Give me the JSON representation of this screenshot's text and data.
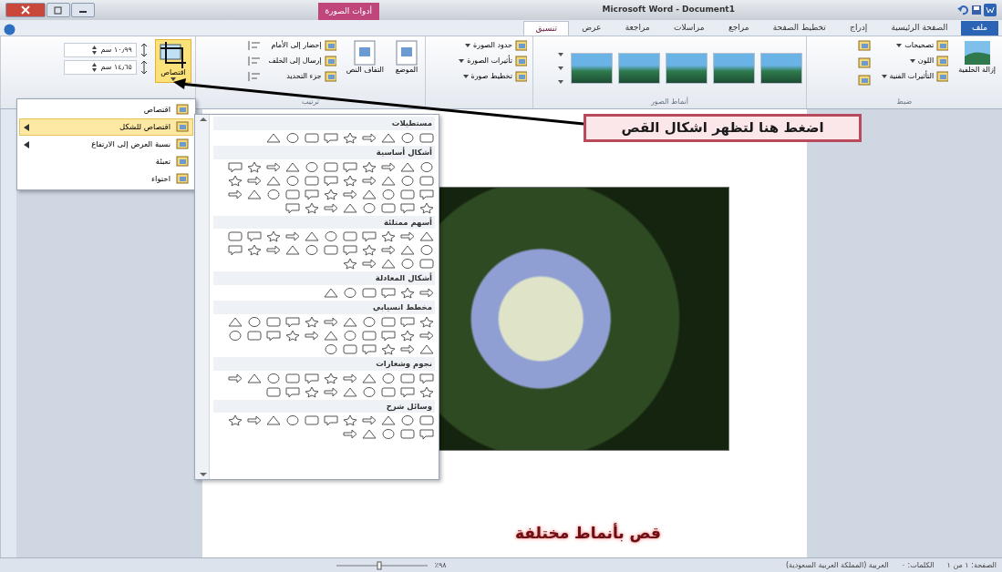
{
  "window": {
    "title": "Microsoft Word - Document1",
    "context_tab_header": "أدوات الصورة"
  },
  "tabs": [
    {
      "label": "ملف",
      "kind": "file",
      "selected": false
    },
    {
      "label": "الصفحة الرئيسية",
      "kind": "tab",
      "selected": false
    },
    {
      "label": "إدراج",
      "kind": "tab",
      "selected": false
    },
    {
      "label": "تخطيط الصفحة",
      "kind": "tab",
      "selected": false
    },
    {
      "label": "مراجع",
      "kind": "tab",
      "selected": false
    },
    {
      "label": "مراسلات",
      "kind": "tab",
      "selected": false
    },
    {
      "label": "مراجعة",
      "kind": "tab",
      "selected": false
    },
    {
      "label": "عرض",
      "kind": "tab",
      "selected": false
    },
    {
      "label": "تنسيق",
      "kind": "context",
      "selected": true
    }
  ],
  "ribbon": {
    "adjust": {
      "label": "ضبط",
      "remove_background": "إزالة الخلفية",
      "items": [
        "تصحيحات",
        "اللون",
        "التأثيرات الفنية"
      ]
    },
    "styles": {
      "label": "أنماط الصور"
    },
    "picture_options": [
      "حدود الصورة",
      "تأثيرات الصورة",
      "تخطيط صورة"
    ],
    "arrange": {
      "label": "ترتيب",
      "position": "الموضع",
      "wrap_text": "التفاف النص",
      "items": [
        "إحضار إلى الأمام",
        "إرسال إلى الخلف",
        "جزء التحديد"
      ]
    },
    "size": {
      "crop": "اقتصاص",
      "height": "١٠٫٩٩ سم",
      "width": "١٤٫٦٥ سم",
      "crop_active": true
    }
  },
  "crop_menu": [
    {
      "label": "اقتصاص",
      "submenu": false,
      "selected": false
    },
    {
      "label": "اقتصاص للشكل",
      "submenu": true,
      "selected": true
    },
    {
      "label": "نسبة العرض إلى الارتفاع",
      "submenu": true,
      "selected": false
    },
    {
      "label": "تعبئة",
      "submenu": false,
      "selected": false
    },
    {
      "label": "احتواء",
      "submenu": false,
      "selected": false
    }
  ],
  "shape_gallery": [
    {
      "heading": "مستطيلات"
    },
    {
      "heading": "أشكال أساسية"
    },
    {
      "heading": "أسهم ممتلئة"
    },
    {
      "heading": "أشكال المعادلة"
    },
    {
      "heading": "مخطط انسيابي"
    },
    {
      "heading": "نجوم وشعارات"
    },
    {
      "heading": "وسائل شرح"
    }
  ],
  "callout": "اضغط هنا لتظهر اشكال القص",
  "caption": "قص بأنماط مختلفة",
  "status_bar": {
    "page": "الصفحة: ١ من ١",
    "words": "الكلمات: ٠",
    "language": "العربية (المملكة العربية السعودية)",
    "zoom": "٩٨٪"
  }
}
